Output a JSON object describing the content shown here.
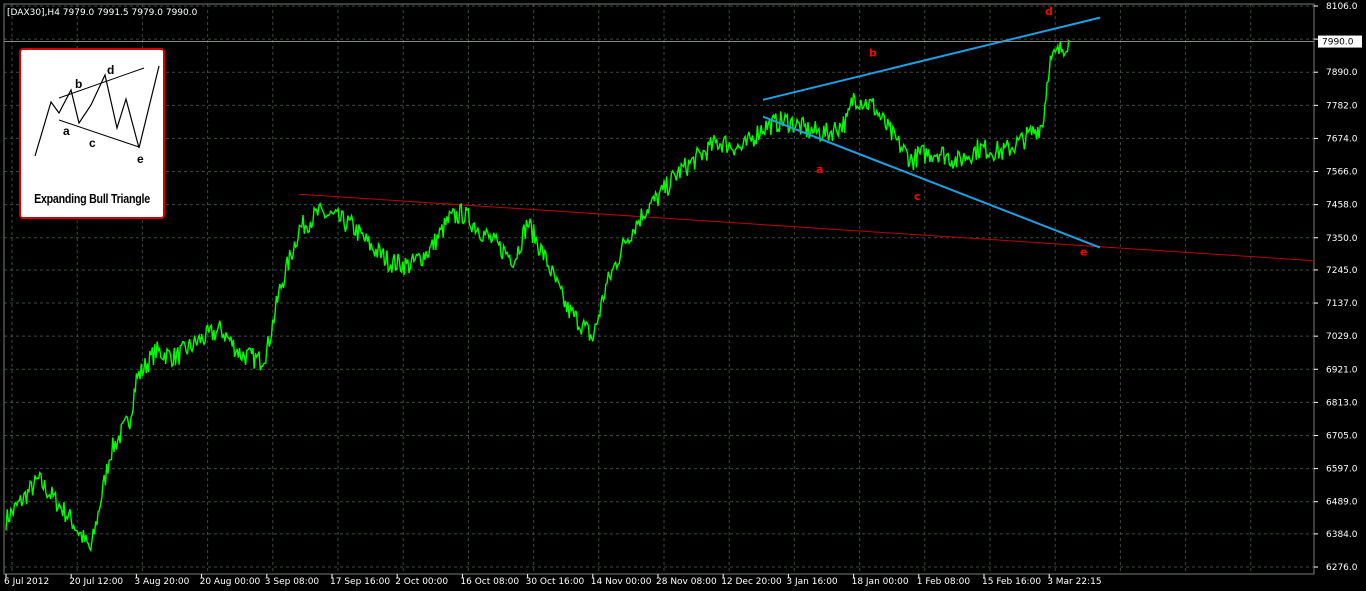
{
  "header": {
    "text": "[DAX30],H4  7979.0 7991.5 7979.0 7990.0"
  },
  "colors": {
    "background": "#000000",
    "grid": "#3c4a3c",
    "price": "#00ff00",
    "channel": "#1ea0e6",
    "support": "#c00000",
    "wave_label": "#ff0000",
    "axis": "#ffffff"
  },
  "inset": {
    "title": "Expanding Bull Triangle",
    "labels": [
      "a",
      "b",
      "c",
      "d",
      "e"
    ]
  },
  "chart_data": {
    "type": "line",
    "title": "[DAX30],H4",
    "ohlc_last": {
      "open": 7979.0,
      "high": 7991.5,
      "low": 7979.0,
      "close": 7990.0
    },
    "current_price": "7990.0",
    "y_ticks": [
      "8106.0",
      "7998.0",
      "7890.0",
      "7782.0",
      "7674.0",
      "7566.0",
      "7458.0",
      "7350.0",
      "7245.0",
      "7137.0",
      "7029.0",
      "6921.0",
      "6813.0",
      "6705.0",
      "6597.0",
      "6489.0",
      "6384.0",
      "6276.0"
    ],
    "ylim": [
      6276,
      8106
    ],
    "x_ticks": [
      "6 Jul 2012",
      "20 Jul 12:00",
      "3 Aug 20:00",
      "20 Aug 00:00",
      "3 Sep 08:00",
      "17 Sep 16:00",
      "2 Oct 00:00",
      "16 Oct 08:00",
      "30 Oct 16:00",
      "14 Nov 00:00",
      "28 Nov 08:00",
      "12 Dec 20:00",
      "3 Jan 16:00",
      "18 Jan 00:00",
      "1 Feb 08:00",
      "15 Feb 16:00",
      "3 Mar 22:15"
    ],
    "series": [
      {
        "values_x_tick_index": [
          0,
          0.5,
          1,
          1.3,
          1.6,
          1.9,
          2,
          2.3,
          2.6,
          3,
          3.3,
          3.6,
          3.9,
          4,
          4.2,
          4.5,
          4.8,
          5,
          5.3,
          5.6,
          5.9,
          6.2,
          6.5,
          6.8,
          7,
          7.2,
          7.5,
          7.8,
          8,
          8.3,
          8.6,
          8.9,
          9,
          9.2,
          9.5,
          9.8,
          10,
          10.3,
          10.6,
          10.9,
          11,
          11.3,
          11.6,
          11.9,
          12,
          12.3,
          12.6,
          12.9,
          13,
          13.3,
          13.6,
          13.9,
          14,
          14.3,
          14.6,
          14.9,
          15,
          15.3,
          15.6,
          15.9,
          16,
          16.3
        ],
        "values": [
          6430,
          6560,
          6430,
          6330,
          6650,
          6760,
          6890,
          6980,
          6960,
          7020,
          7050,
          6970,
          6950,
          6980,
          7180,
          7380,
          7430,
          7420,
          7390,
          7320,
          7270,
          7260,
          7310,
          7410,
          7430,
          7390,
          7330,
          7280,
          7400,
          7270,
          7120,
          7050,
          7020,
          7190,
          7340,
          7440,
          7480,
          7560,
          7610,
          7660,
          7660,
          7640,
          7710,
          7730,
          7730,
          7700,
          7690,
          7730,
          7810,
          7780,
          7680,
          7600,
          7620,
          7630,
          7600,
          7640,
          7640,
          7630,
          7670,
          7720,
          7920,
          7995
        ]
      }
    ],
    "wave_labels": [
      {
        "label": "a",
        "value": 7575
      },
      {
        "label": "b",
        "value": 7955
      },
      {
        "label": "c",
        "value": 7486
      },
      {
        "label": "d",
        "value": 8090
      },
      {
        "label": "e",
        "value": 7305
      }
    ],
    "channel_upper": {
      "from_value": 7800,
      "to_value": 8068
    },
    "channel_lower": {
      "from_value": 7745,
      "to_value": 7318
    },
    "support_line": {
      "from_value": 7492,
      "to_value": 7275
    },
    "grid": true
  }
}
